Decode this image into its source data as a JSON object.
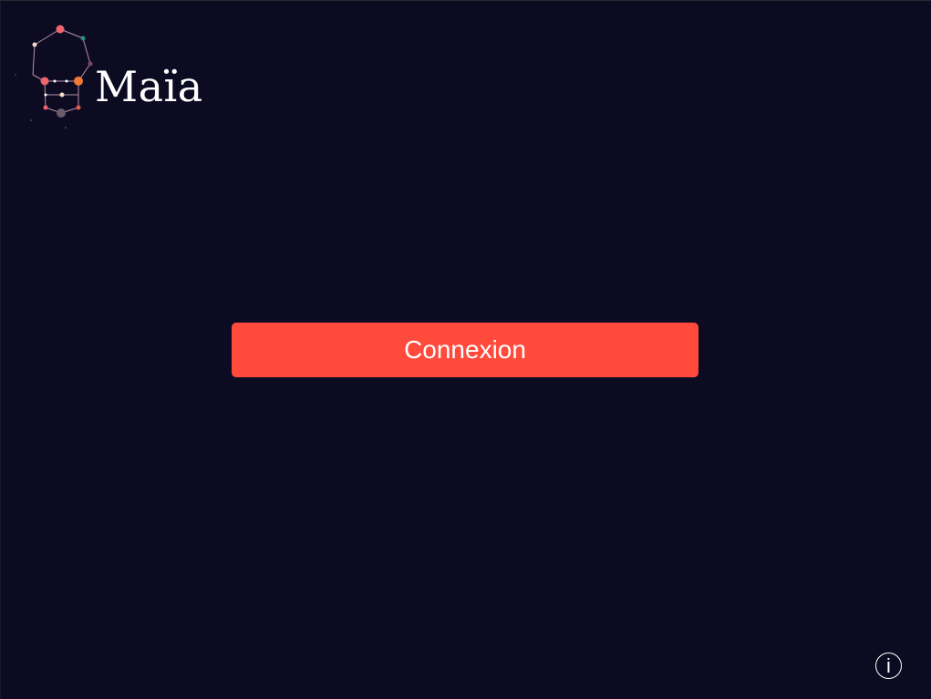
{
  "app": {
    "name": "Maïa"
  },
  "main": {
    "login_button_label": "Connexion"
  },
  "footer": {
    "info_icon_glyph": "i"
  },
  "icons": {
    "logo": "constellation-logo-icon",
    "info": "info-icon"
  },
  "colors": {
    "background": "#0c0b22",
    "accent": "#ff4a3c",
    "text": "#ffffff"
  }
}
